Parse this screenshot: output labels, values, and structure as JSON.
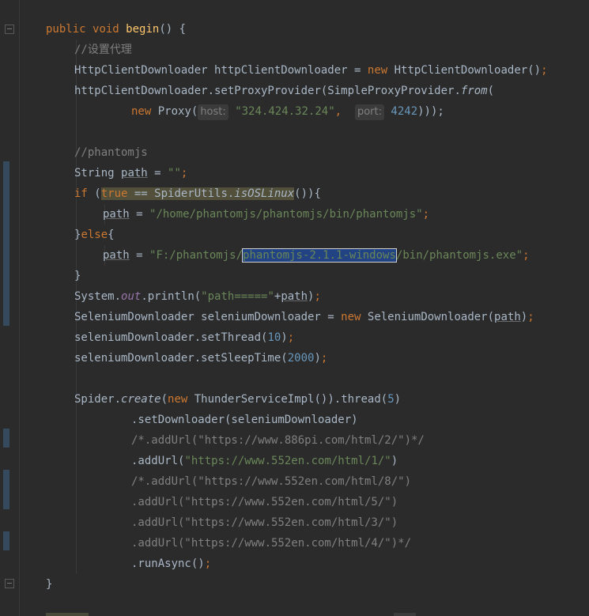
{
  "code": {
    "l1": {
      "kw1": "public",
      "kw2": "void",
      "fn": "begin",
      "rest": "() {"
    },
    "l2": {
      "comment": "//设置代理"
    },
    "l3": {
      "type": "HttpClientDownloader",
      "var": "httpClientDownloader",
      "eq": " = ",
      "kw": "new",
      "ctor": "HttpClientDownloader",
      "tail": "()",
      "semi": ";"
    },
    "l4": {
      "obj": "httpClientDownloader",
      "call": ".setProxyProvider(SimpleProxyProvider.",
      "method": "from",
      "tail": "("
    },
    "l5": {
      "kw": "new",
      "cls": "Proxy(",
      "hint1": "host:",
      "str": "\"324.424.32.24\"",
      "comma": ",",
      "hint2": "port:",
      "num": "4242",
      "tail": ")));"
    },
    "l7": {
      "comment": "//phantomjs"
    },
    "l8": {
      "type": "String",
      "var": "path",
      "eq": " = ",
      "str": "\"\"",
      "semi": ";"
    },
    "l9": {
      "kw": "if",
      "open": " (",
      "kw_true": "true",
      "mid": " == SpiderUtils.",
      "method": "isOSLinux",
      "tail": "()){"
    },
    "l10": {
      "var": "path",
      "eq": " = ",
      "str": "\"/home/phantomjs/phantomjs/bin/phantomjs\"",
      "semi": ";"
    },
    "l11": {
      "open": "}",
      "kw": "else",
      "tail": "{"
    },
    "l12": {
      "var": "path",
      "eq": " = ",
      "str_a": "\"F:/phantomjs/",
      "str_sel": "phantomjs-2.1.1-windows",
      "str_b": "/bin/phantomjs.exe\"",
      "semi": ";"
    },
    "l13": {
      "text": "}"
    },
    "l14": {
      "obj": "System.",
      "field": "out",
      "call": ".println(",
      "str": "\"path=====\"",
      "plus": "+",
      "var": "path",
      "tail": ")",
      "semi": ";"
    },
    "l15": {
      "type": "SeleniumDownloader",
      "var": " seleniumDownloader",
      "eq": " = ",
      "kw": "new",
      "ctor": " SeleniumDownloader(",
      "arg": "path",
      "tail": ")",
      "semi": ";"
    },
    "l16": {
      "obj": "seleniumDownloader.setThread(",
      "num": "10",
      "tail": ")",
      "semi": ";"
    },
    "l17": {
      "obj": "seleniumDownloader.setSleepTime(",
      "num": "2000",
      "tail": ")",
      "semi": ";"
    },
    "l19": {
      "obj": "Spider.",
      "method": "create",
      "open": "(",
      "kw": "new",
      "cls": " ThunderServiceImpl()).thread(",
      "num": "5",
      "tail": ")"
    },
    "l20": {
      "text": ".setDownloader(seleniumDownloader)"
    },
    "l21": {
      "comment": "/*.addUrl(\"https://www.886pi.com/html/2/\")*/"
    },
    "l22": {
      "call": ".addUrl(",
      "str": "\"https://www.552en.com/html/1/\"",
      "tail": ")"
    },
    "l23": {
      "comment": "/*.addUrl(\"https://www.552en.com/html/8/\")"
    },
    "l24": {
      "comment": ".addUrl(\"https://www.552en.com/html/5/\")"
    },
    "l25": {
      "comment": ".addUrl(\"https://www.552en.com/html/3/\")"
    },
    "l26": {
      "comment": ".addUrl(\"https://www.552en.com/html/4/\")*/"
    },
    "l27": {
      "call": ".runAsync()",
      "semi": ";"
    },
    "l28": {
      "text": "}"
    }
  },
  "colors": {
    "background": "#2b2b2b",
    "keyword": "#cc7832",
    "function": "#ffc66d",
    "string": "#6a8759",
    "number": "#6897bb",
    "comment": "#808080",
    "text": "#a9b7c6"
  }
}
